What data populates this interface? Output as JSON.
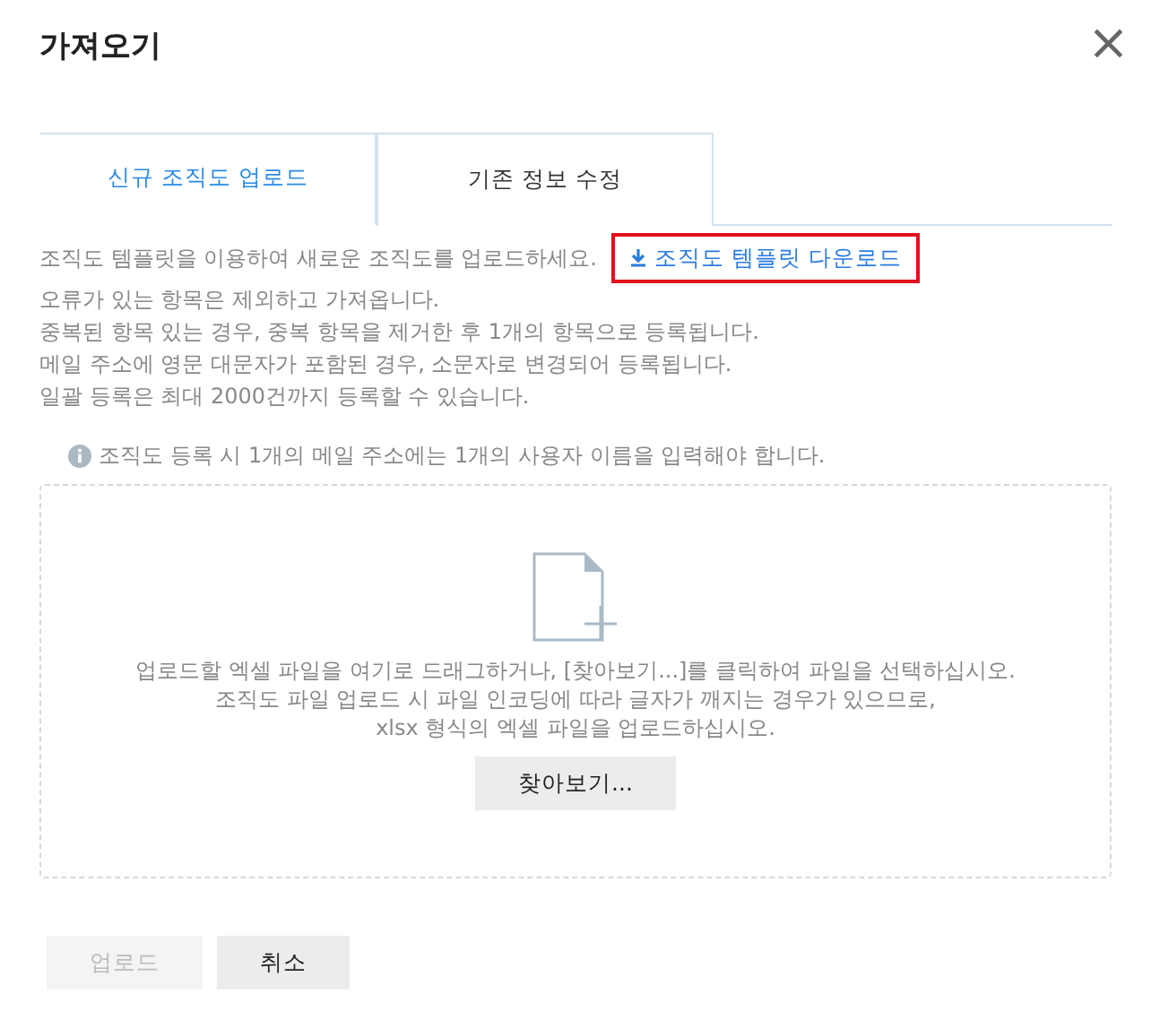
{
  "dialog": {
    "title": "가져오기",
    "close": "×"
  },
  "tabs": [
    {
      "label": "신규 조직도 업로드",
      "selected": true
    },
    {
      "label": "기존 정보 수정",
      "selected": false
    }
  ],
  "intro": {
    "text": "조직도 템플릿을 이용하여 새로운 조직도를 업로드하세요.",
    "download_link": {
      "label": "조직도 템플릿 다운로드",
      "highlighted": true
    }
  },
  "notes": [
    "오류가 있는 항목은 제외하고 가져옵니다.",
    "중복된 항목 있는 경우, 중복 항목을 제거한 후 1개의 항목으로 등록됩니다.",
    "메일 주소에 영문 대문자가 포함된 경우, 소문자로 변경되어 등록됩니다.",
    "일괄 등록은 최대 2000건까지 등록할 수 있습니다."
  ],
  "info": "조직도 등록 시 1개의 메일 주소에는 1개의 사용자 이름을 입력해야 합니다.",
  "dropzone": {
    "lines": [
      "업로드할 엑셀 파일을 여기로 드래그하거나, [찾아보기...]를 클릭하여 파일을 선택하십시오.",
      "조직도 파일 업로드 시 파일 인코딩에 따라 글자가 깨지는 경우가 있으므로,",
      "xlsx 형식의 엑셀 파일을 업로드하십시오."
    ],
    "browse_button": "찾아보기..."
  },
  "buttons": [
    {
      "label": "업로드",
      "disabled": true
    },
    {
      "label": "취소",
      "disabled": false
    }
  ]
}
